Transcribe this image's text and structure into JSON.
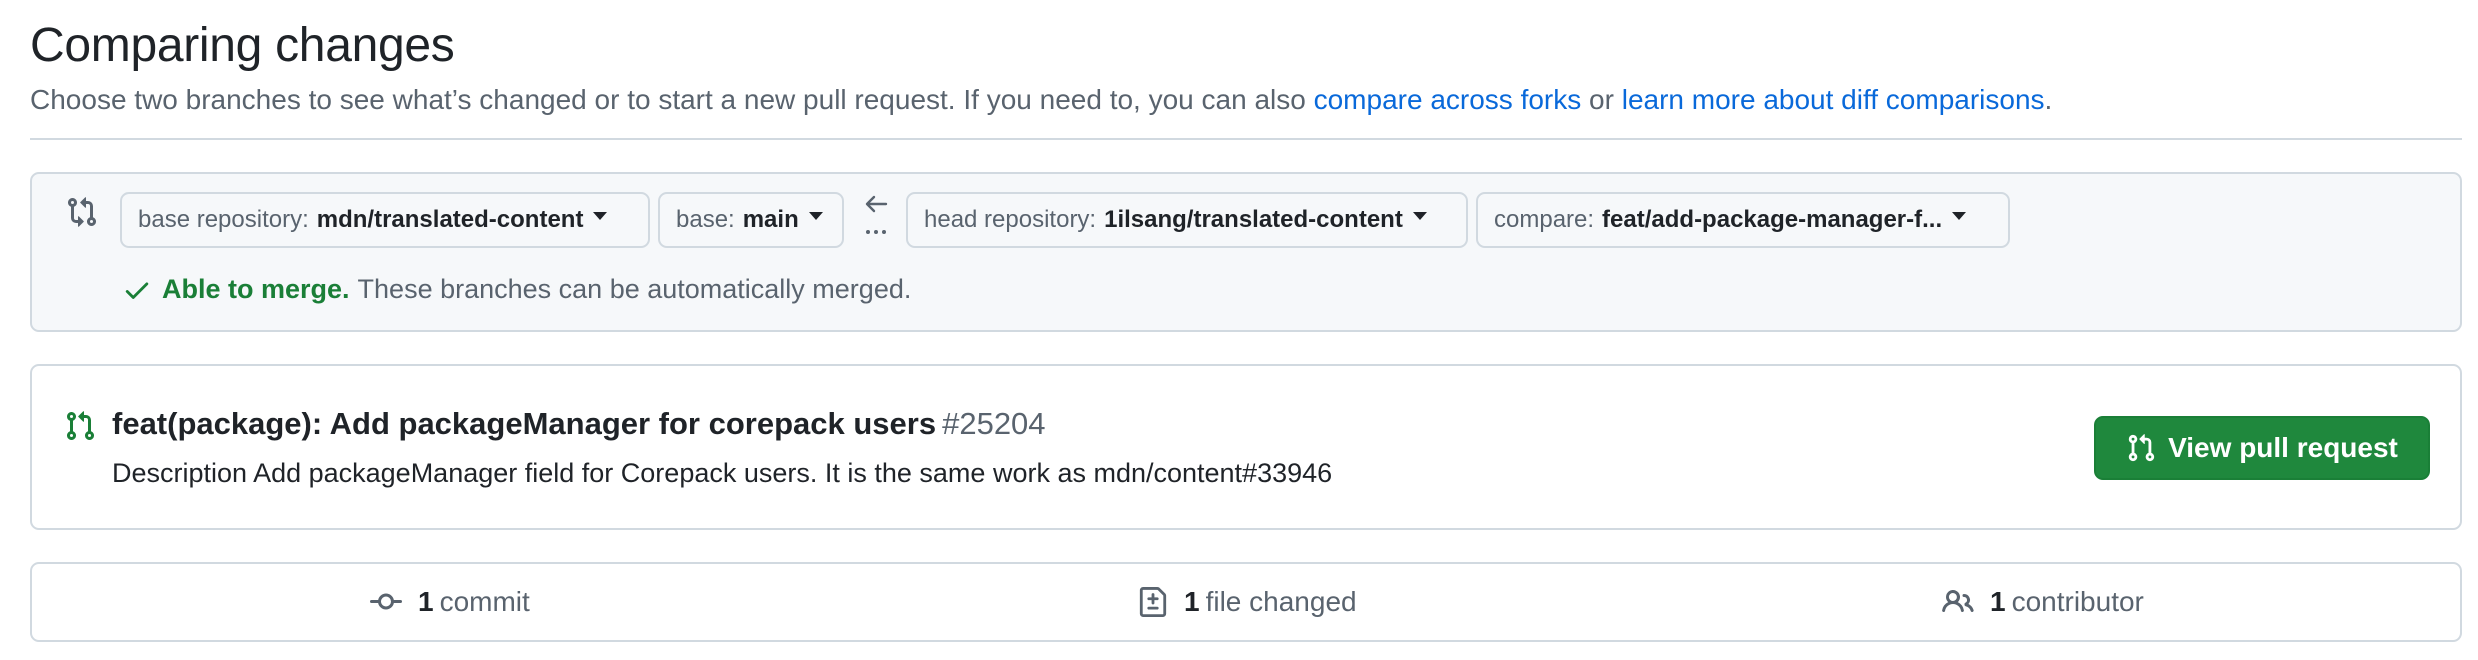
{
  "header": {
    "title": "Comparing changes",
    "description_prefix": "Choose two branches to see what’s changed or to start a new pull request. If you need to, you can also ",
    "link_forks": "compare across forks",
    "description_middle": " or ",
    "link_learn": "learn more about diff comparisons",
    "description_suffix": "."
  },
  "range": {
    "base_repo_label": "base repository:",
    "base_repo_value": "mdn/translated-content",
    "base_label": "base:",
    "base_value": "main",
    "head_repo_label": "head repository:",
    "head_repo_value": "1ilsang/translated-content",
    "compare_label": "compare:",
    "compare_value": "feat/add-package-manager-f...",
    "merge_ok": "Able to merge.",
    "merge_msg": "These branches can be automatically merged."
  },
  "pull_request": {
    "title": "feat(package): Add packageManager for corepack users",
    "number": "#25204",
    "description": "Description Add packageManager field for Corepack users. It is the same work as mdn/content#33946",
    "view_button": "View pull request"
  },
  "stats": {
    "commits_count": "1",
    "commits_label": "commit",
    "files_count": "1",
    "files_label": "file changed",
    "contributors_count": "1",
    "contributors_label": "contributor"
  },
  "colors": {
    "link": "#0969da",
    "success": "#1a7f37",
    "button_green": "#1f883d",
    "border": "#d1d9e0",
    "muted": "#59636e"
  },
  "icons": {
    "compare": "git-compare-icon",
    "swap": "arrow-left-icon",
    "check": "check-icon",
    "pull_request": "git-pull-request-icon",
    "commit": "git-commit-icon",
    "file_diff": "file-diff-icon",
    "people": "people-icon"
  }
}
